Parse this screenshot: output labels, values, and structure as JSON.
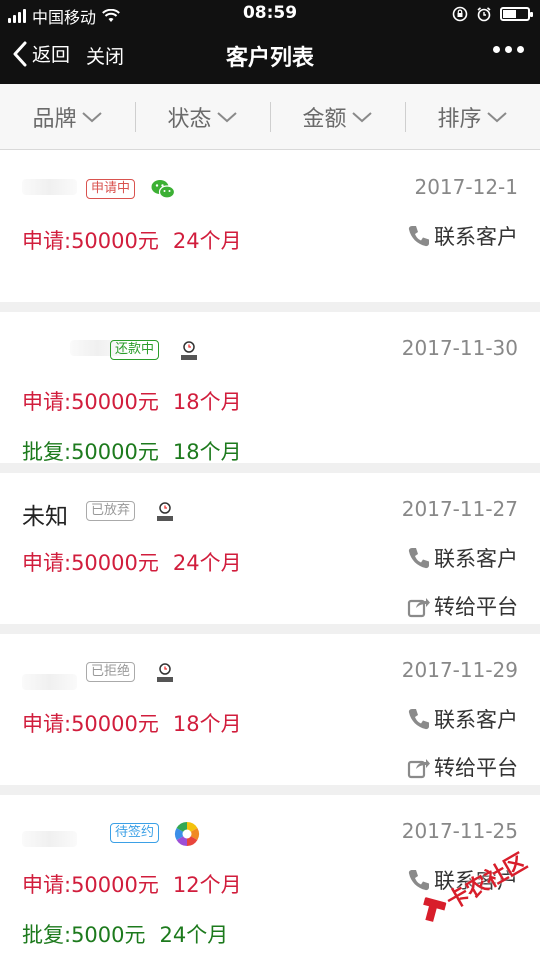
{
  "status_bar": {
    "carrier": "中国移动",
    "time": "08:59",
    "battery_level": 0.55
  },
  "nav": {
    "back_label": "返回",
    "close_label": "关闭",
    "title": "客户列表"
  },
  "filters": [
    {
      "label": "品牌"
    },
    {
      "label": "状态"
    },
    {
      "label": "金额"
    },
    {
      "label": "排序"
    }
  ],
  "customers": [
    {
      "name": "",
      "status": "申请中",
      "status_color": "#d9534f",
      "source_icon": "wechat-icon",
      "date": "2017-12-1",
      "apply_label": "申请:50000元",
      "apply_term": "24个月",
      "approve_label": "",
      "approve_term": "",
      "action1": "联系客户",
      "action2": ""
    },
    {
      "name": "",
      "status": "还款中",
      "status_color": "#2a9d2a",
      "source_icon": "alarm-app-icon",
      "date": "2017-11-30",
      "apply_label": "申请:50000元",
      "apply_term": "18个月",
      "approve_label": "批复:50000元",
      "approve_term": "18个月",
      "action1": "",
      "action2": ""
    },
    {
      "name": "未知",
      "status": "已放弃",
      "status_color": "#999999",
      "source_icon": "alarm-app-icon",
      "date": "2017-11-27",
      "apply_label": "申请:50000元",
      "apply_term": "24个月",
      "approve_label": "",
      "approve_term": "",
      "action1": "联系客户",
      "action2": "转给平台"
    },
    {
      "name": "",
      "status": "已拒绝",
      "status_color": "#999999",
      "source_icon": "alarm-app-icon",
      "date": "2017-11-29",
      "apply_label": "申请:50000元",
      "apply_term": "18个月",
      "approve_label": "",
      "approve_term": "",
      "action1": "联系客户",
      "action2": "转给平台"
    },
    {
      "name": "",
      "status": "待签约",
      "status_color": "#3ba0e6",
      "source_icon": "aperture-icon",
      "date": "2017-11-25",
      "apply_label": "申请:50000元",
      "apply_term": "12个月",
      "approve_label": "批复:5000元",
      "approve_term": "24个月",
      "action1": "联系客户",
      "action2": ""
    }
  ],
  "watermark": {
    "text": "卡农社区"
  }
}
